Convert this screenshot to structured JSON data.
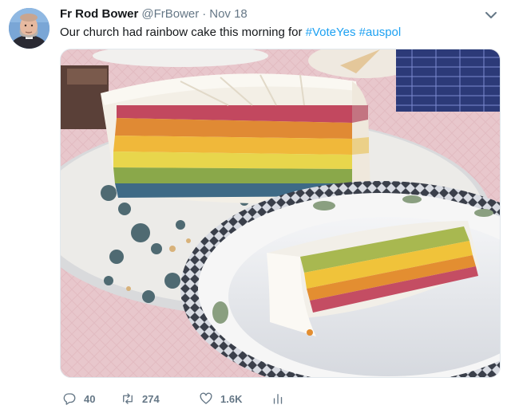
{
  "tweet": {
    "display_name": "Fr Rod Bower",
    "handle": "@FrBower",
    "separator": "·",
    "date": "Nov 18",
    "text_plain": "Our church had rainbow cake this morning for ",
    "hashtag_1": "#VoteYes",
    "hashtag_2": "#auspol",
    "link_color": "#1da1f2"
  },
  "media": {
    "alt": "Rainbow layered cake with a slice on a patterned plate"
  },
  "actions": {
    "replies": "40",
    "retweets": "274",
    "likes": "1.6K"
  },
  "icons": {
    "menu": "chevron-down-icon",
    "reply": "reply-icon",
    "retweet": "retweet-icon",
    "like": "heart-icon",
    "analytics": "analytics-icon"
  }
}
